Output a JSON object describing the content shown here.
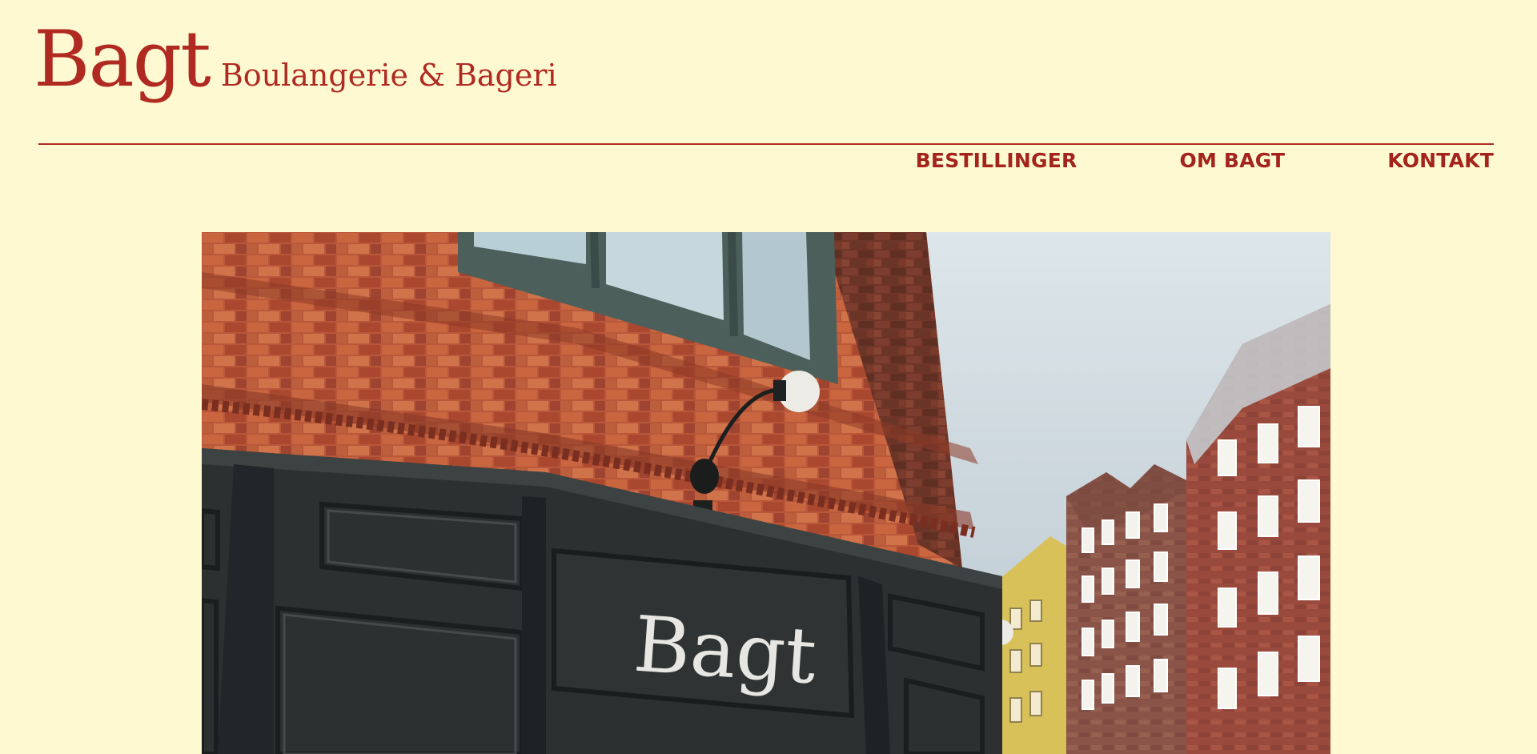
{
  "brand": {
    "name": "Bagt",
    "tagline": "Boulangerie & Bageri"
  },
  "nav": {
    "items": [
      {
        "label": "BESTILLINGER"
      },
      {
        "label": "OM BAGT"
      },
      {
        "label": "KONTAKT"
      }
    ]
  },
  "hero": {
    "sign_text": "Bagt"
  },
  "colors": {
    "background": "#fef9d1",
    "brand_red": "#b02a22"
  }
}
